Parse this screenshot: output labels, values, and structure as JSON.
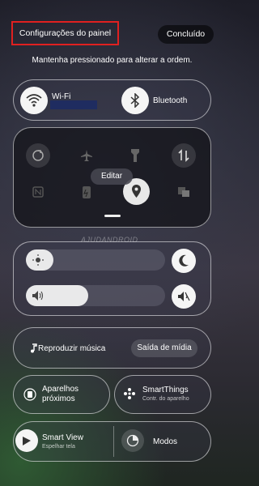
{
  "header": {
    "title": "Configurações do painel",
    "done_label": "Concluído"
  },
  "hint": "Mantenha pressionado para alterar a ordem.",
  "top_tiles": {
    "wifi": {
      "label": "Wi-Fi",
      "icon": "wifi-icon"
    },
    "bluetooth": {
      "label": "Bluetooth",
      "icon": "bluetooth-icon"
    }
  },
  "quick_grid": {
    "icons": [
      "auto-rotate-icon",
      "airplane-icon",
      "flashlight-icon",
      "mobile-data-icon",
      "nfc-icon",
      "power-saving-icon",
      "location-icon",
      "multi-window-icon"
    ],
    "edit_label": "Editar"
  },
  "watermark": "AJUDANDROID",
  "sliders": {
    "brightness": {
      "icon": "sun-icon",
      "level": 0.2
    },
    "volume": {
      "icon": "speaker-icon",
      "level": 0.45
    }
  },
  "side_buttons": {
    "dark_mode": "moon-icon",
    "mute": "mute-icon"
  },
  "media": {
    "label": "Reproduzir música",
    "output_label": "Saída de mídia"
  },
  "devices": {
    "nearby": {
      "label_line1": "Aparelhos",
      "label_line2": "próximos"
    },
    "smartthings": {
      "label": "SmartThings",
      "sub": "Contr. do aparelho"
    }
  },
  "bottom": {
    "smart_view": {
      "label": "Smart View",
      "sub": "Espelhar tela"
    },
    "modes": {
      "label": "Modos"
    }
  }
}
